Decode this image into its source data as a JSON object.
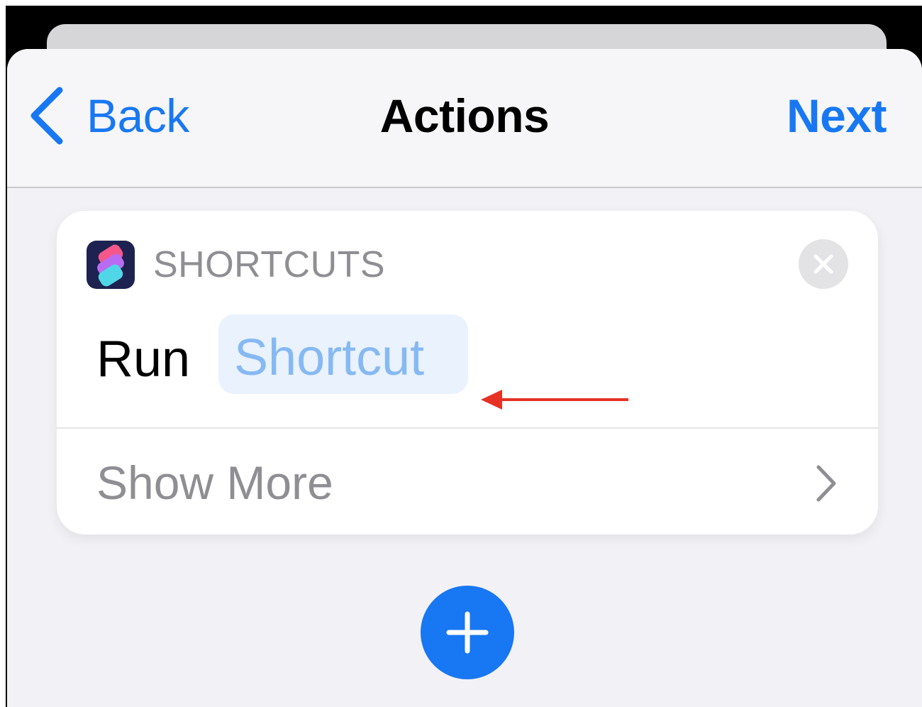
{
  "nav": {
    "back_label": "Back",
    "title": "Actions",
    "next_label": "Next"
  },
  "action_card": {
    "app_name": "SHORTCUTS",
    "verb": "Run",
    "parameter": "Shortcut",
    "show_more_label": "Show More"
  },
  "icons": {
    "back": "chevron-left-icon",
    "app": "shortcuts-app-icon",
    "close": "close-icon",
    "show_more": "chevron-right-icon",
    "annotation": "arrow-left-icon",
    "add": "plus-icon"
  },
  "colors": {
    "accent": "#1878f3",
    "token_background": "#e9f2fd",
    "token_text": "#86b9f3",
    "annotation": "#e53224",
    "secondary_text": "#8e8e93",
    "sheet_background": "#f2f2f6"
  }
}
